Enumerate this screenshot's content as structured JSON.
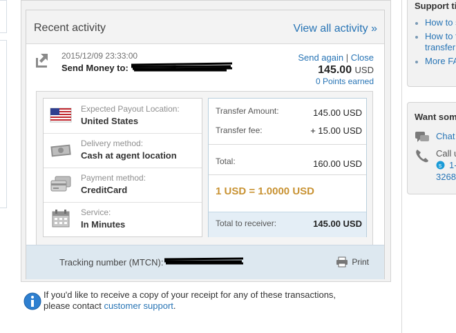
{
  "recent_activity": {
    "title": "Recent activity",
    "view_all": "View all activity »"
  },
  "transaction": {
    "date": "2015/12/09 23:33:00",
    "send_prefix": "Send Money to:",
    "send_again": "Send again",
    "separator": "|",
    "close": "Close",
    "amount": "145.00",
    "currency": "USD",
    "points": "0 Points earned"
  },
  "details": [
    {
      "icon": "us-flag-icon",
      "label": "Expected Payout Location:",
      "value": "United States"
    },
    {
      "icon": "cash-icon",
      "label": "Delivery method:",
      "value": "Cash at agent location"
    },
    {
      "icon": "credit-card-icon",
      "label": "Payment method:",
      "value": "CreditCard"
    },
    {
      "icon": "calendar-icon",
      "label": "Service:",
      "value": "In Minutes"
    }
  ],
  "summary": {
    "transfer_amount_label": "Transfer Amount:",
    "transfer_amount_value": "145.00 USD",
    "transfer_fee_label": "Transfer fee:",
    "transfer_fee_value": "+ 15.00 USD",
    "total_label": "Total:",
    "total_value": "160.00 USD",
    "rate": "1 USD = 1.0000 USD",
    "receiver_label": "Total to receiver:",
    "receiver_value": "145.00 USD"
  },
  "tracking": {
    "label": "Tracking number (MTCN):",
    "print": "Print"
  },
  "notice": {
    "text": "If you'd like to receive a copy of your receipt for any of these transactions, please contact ",
    "link": "customer support",
    "end": "."
  },
  "right_panel": {
    "support_title": "Support ti",
    "support_links": [
      "How to s",
      "How to t",
      "transfer",
      "More FA"
    ],
    "want_title": "Want som",
    "chat": "Chat",
    "call": "Call u",
    "phone1": "1-",
    "phone2": "3268"
  },
  "colors": {
    "link": "#2774b5",
    "rate": "#c89232",
    "panel_bg": "#f2f2f2"
  }
}
